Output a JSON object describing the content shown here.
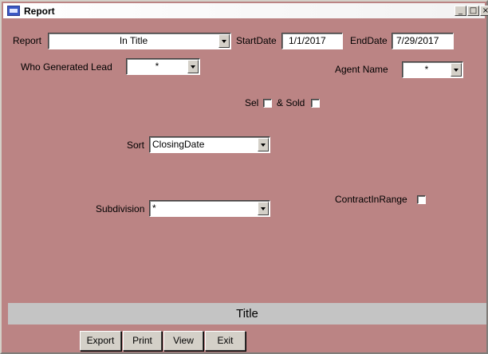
{
  "window": {
    "title": "Report",
    "icon": "form-icon",
    "controls": [
      "minimize-icon",
      "maximize-icon",
      "close-icon"
    ]
  },
  "form": {
    "report": {
      "label": "Report",
      "value": "In Title"
    },
    "start_date": {
      "label": "StartDate",
      "value": "1/1/2017"
    },
    "end_date": {
      "label": "EndDate",
      "value": "7/29/2017"
    },
    "who_generated": {
      "label": "Who Generated Lead",
      "value": "*"
    },
    "agent_name": {
      "label": "Agent Name",
      "value": "*"
    },
    "sel": {
      "label": "Sel",
      "checked": false
    },
    "sold": {
      "label": "& Sold",
      "checked": false
    },
    "sort": {
      "label": "Sort",
      "value": "ClosingDate"
    },
    "subdivision": {
      "label": "Subdivision",
      "value": "*"
    },
    "contract_in_range": {
      "label": "ContractInRange",
      "checked": false
    }
  },
  "footer": {
    "title": "Title"
  },
  "buttons": {
    "export": "Export",
    "print": "Print",
    "view": "View",
    "exit": "Exit"
  },
  "colors": {
    "form_bg": "#bb8484",
    "footer_bg": "#c4c4c4",
    "button_face": "#d4d0c8"
  }
}
